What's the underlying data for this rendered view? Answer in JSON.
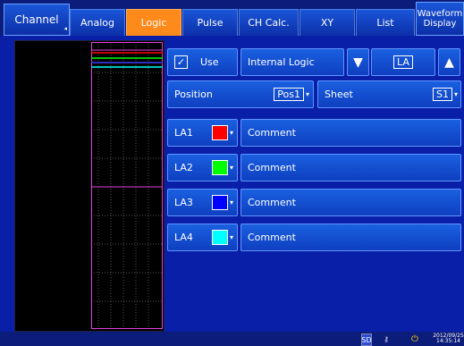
{
  "tabs": {
    "channel": "Channel",
    "analog": "Analog",
    "logic": "Logic",
    "pulse": "Pulse",
    "ch_calc": "CH Calc.",
    "xy": "XY",
    "list": "List",
    "waveform_display_line1": "Waveform",
    "waveform_display_line2": "Display"
  },
  "panel": {
    "use_checkbox_checked": true,
    "use_label": "Use",
    "source_label": "Internal Logic",
    "unit_value": "LA",
    "position_label": "Position",
    "position_value": "Pos1",
    "sheet_label": "Sheet",
    "sheet_value": "S1",
    "comment_placeholder": "Comment",
    "channels": [
      {
        "name": "LA1",
        "color": "#ff0000"
      },
      {
        "name": "LA2",
        "color": "#00ff00"
      },
      {
        "name": "LA3",
        "color": "#0000ff"
      },
      {
        "name": "LA4",
        "color": "#00ffff"
      }
    ]
  },
  "waveform": {
    "trace_colors": [
      "#ff0000",
      "#00ff00",
      "#0000ff",
      "#00ffff"
    ]
  },
  "statusbar": {
    "memory_icon": "sd-card-icon",
    "lock_icon": "key-icon",
    "power_icon": "power-plug-icon",
    "date": "2012/09/25",
    "time": "14:35:14"
  }
}
